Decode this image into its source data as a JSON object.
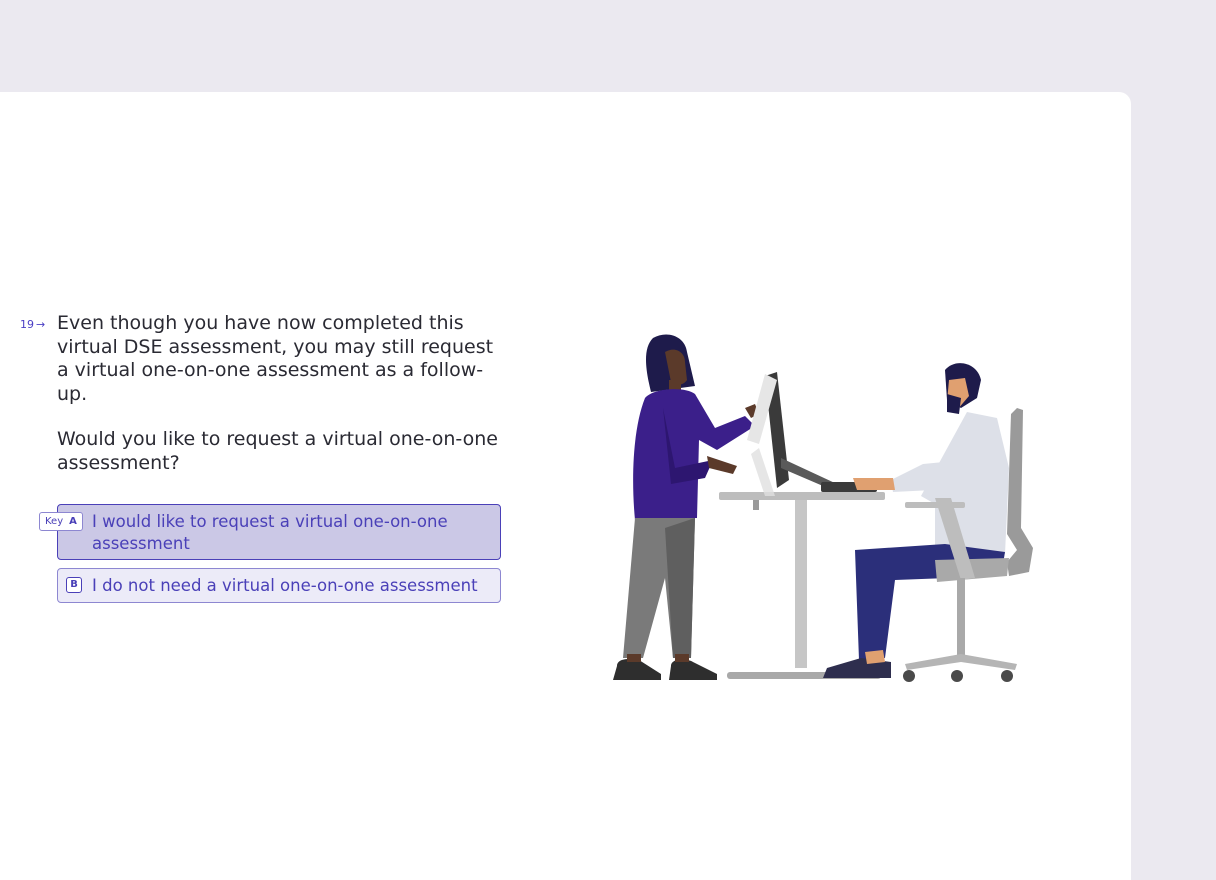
{
  "question": {
    "number": "19",
    "arrow_icon": "arrow-right-icon",
    "paragraphs": [
      "Even though you have now completed this virtual DSE assessment, you may still request a virtual one-on-one assessment as a follow-up.",
      "Would you like to request a virtual one-on-one assessment?"
    ]
  },
  "key_hint": {
    "label": "Key",
    "key": "A"
  },
  "choices": [
    {
      "key": "A",
      "label": "I would like to request a virtual one-on-one assessment",
      "selected": true
    },
    {
      "key": "B",
      "label": "I do not need a virtual one-on-one assessment",
      "selected": false
    }
  ],
  "colors": {
    "accent": "#4a40b8",
    "page_bg": "#ebe9f0",
    "card_bg": "#ffffff",
    "selected_bg": "#cbc8e6",
    "choice_bg": "#ecebf8"
  }
}
